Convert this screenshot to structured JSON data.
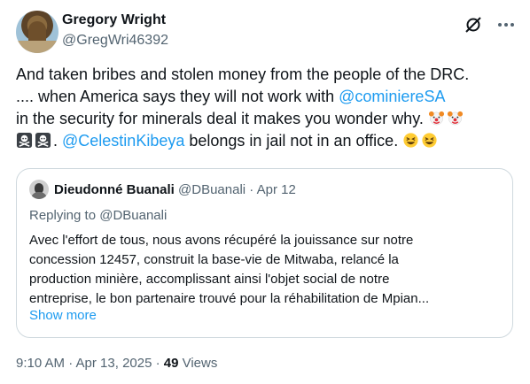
{
  "author": {
    "name": "Gregory Wright",
    "handle": "@GregWri46392"
  },
  "tweet": {
    "line1": "And taken bribes and stolen money from the people of the DRC.",
    "line2_a": ".... when America says they will not work with ",
    "mention1": "@cominiereSA",
    "line3": "in the security for minerals deal  it makes you wonder why.",
    "line4_a": ". ",
    "mention2": "@CelestinKibeya",
    "line4_b": " belongs in jail not in an office."
  },
  "icons": {
    "clown": "clown-face-emoji",
    "skull": "skull-crossbones-emoji",
    "laugh": "grinning-squinting-emoji",
    "grok": "grok-slash-icon",
    "more": "more-dots-icon"
  },
  "quote": {
    "name": "Dieudonné Buanali",
    "handle": "@DBuanali",
    "separator": " · ",
    "date": "Apr 12",
    "replying": "Replying to @DBuanali",
    "lines": [
      "Avec l'effort de tous, nous avons récupéré la jouissance sur notre",
      "concession 12457, construit la base-vie de Mitwaba, relancé la",
      "production minière, accomplissant ainsi l'objet social de notre",
      "entreprise, le bon partenaire trouvé pour la réhabilitation de Mpian..."
    ],
    "show_more": "Show more"
  },
  "footer": {
    "timestamp": "9:10 AM · Apr 13, 2025 · ",
    "views_count": "49",
    "views_label": " Views"
  },
  "colors": {
    "link": "#1d9bf0",
    "secondary_text": "#536471",
    "border": "#cfd9de"
  }
}
